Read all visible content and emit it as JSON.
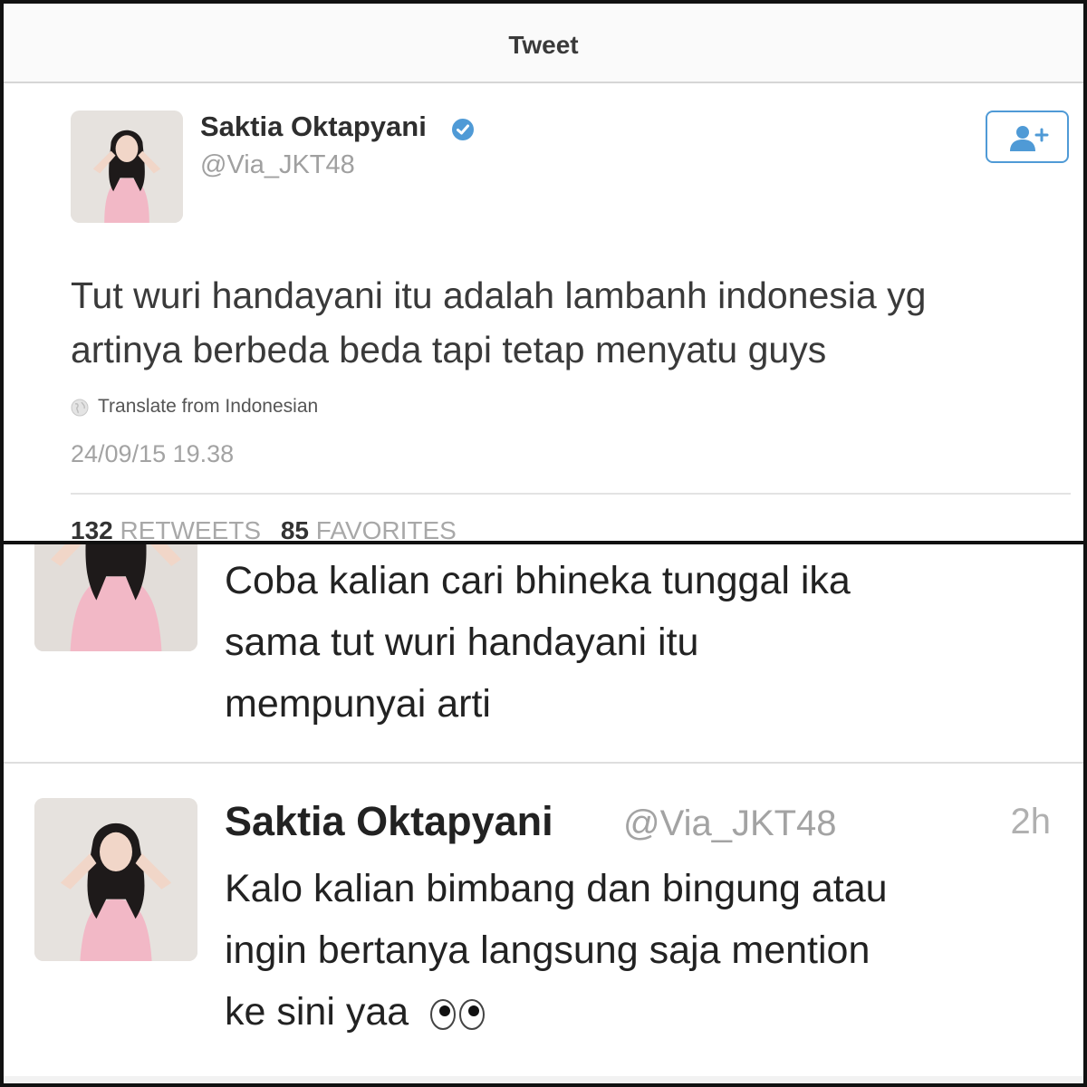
{
  "header": {
    "title": "Tweet"
  },
  "tweet": {
    "author_name": "Saktia Oktapyani",
    "author_handle": "@Via_JKT48",
    "text_line1": "Tut wuri handayani itu adalah lambanh indonesia yg",
    "text_line2": "artinya berbeda beda tapi tetap menyatu guys",
    "translate_label": "Translate from Indonesian",
    "timestamp": "24/09/15 19.38",
    "retweets_count": "132",
    "retweets_label": "RETWEETS",
    "favorites_count": "85",
    "favorites_label": "FAVORITES"
  },
  "feed": [
    {
      "text_line1": "Coba kalian cari bhineka tunggal ika",
      "text_line2": "sama tut wuri handayani itu",
      "text_line3": "mempunyai arti"
    },
    {
      "author_name": "Saktia Oktapyani",
      "author_handle": "@Via_JKT48",
      "time": "2h",
      "text_line1": "Kalo kalian bimbang dan bingung atau",
      "text_line2": "ingin bertanya langsung saja mention",
      "text_line3": "ke sini yaa",
      "emoji": "eyes-icon"
    }
  ],
  "colors": {
    "accent": "#4f9ad6",
    "muted_text": "#a3a3a3",
    "frame": "#111111",
    "avatar_dress": "#f2b8c6"
  }
}
